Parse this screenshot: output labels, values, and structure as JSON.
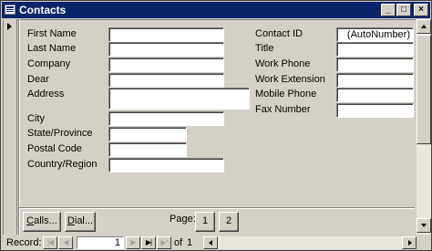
{
  "window": {
    "title": "Contacts",
    "minimize_glyph": "_",
    "maximize_glyph": "□",
    "close_glyph": "×"
  },
  "record_selector": {
    "icon": "current-record-arrow-icon"
  },
  "form": {
    "left_fields": [
      {
        "label": "First Name",
        "value": ""
      },
      {
        "label": "Last Name",
        "value": ""
      },
      {
        "label": "Company",
        "value": ""
      },
      {
        "label": "Dear",
        "value": ""
      },
      {
        "label": "Address",
        "value": ""
      },
      {
        "label": "City",
        "value": ""
      },
      {
        "label": "State/Province",
        "value": ""
      },
      {
        "label": "Postal Code",
        "value": ""
      },
      {
        "label": "Country/Region",
        "value": ""
      }
    ],
    "right_fields": [
      {
        "label": "Contact ID",
        "value": "(AutoNumber)"
      },
      {
        "label": "Title",
        "value": ""
      },
      {
        "label": "Work Phone",
        "value": ""
      },
      {
        "label": "Work Extension",
        "value": ""
      },
      {
        "label": "Mobile Phone",
        "value": ""
      },
      {
        "label": "Fax Number",
        "value": ""
      }
    ]
  },
  "footer": {
    "calls_button": {
      "label_hotkey": "C",
      "label_rest": "alls..."
    },
    "dial_button": {
      "label_hotkey": "D",
      "label_rest": "ial..."
    },
    "page_label": "Page:",
    "pages": [
      "1",
      "2"
    ]
  },
  "navigation": {
    "record_label": "Record:",
    "first_glyph": "|◀",
    "prev_glyph": "◀",
    "next_glyph": "▶",
    "last_glyph": "▶|",
    "new_glyph": "▶*",
    "current_record": "1",
    "of_label": "of",
    "total_records": "1"
  },
  "colors": {
    "titlebar": "#0a246a",
    "face": "#d4d0c8"
  }
}
